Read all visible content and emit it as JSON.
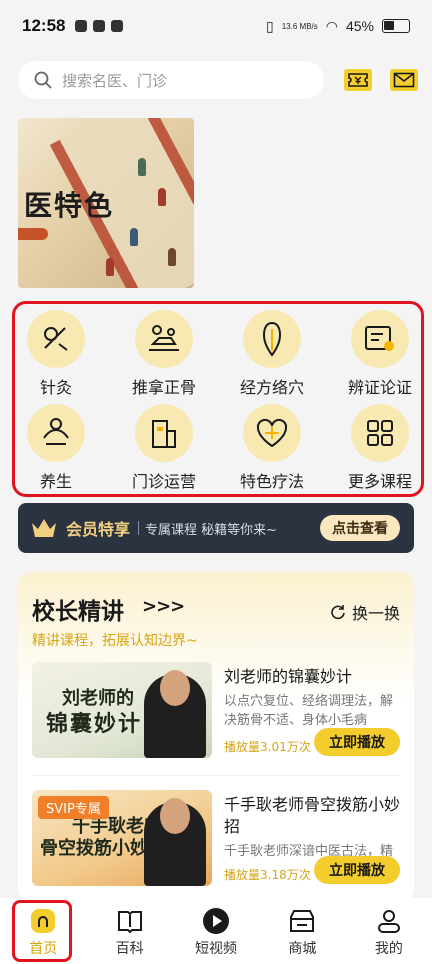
{
  "status_bar": {
    "time": "12:58",
    "speed": "13.6 MB/s",
    "battery": "45%"
  },
  "search": {
    "placeholder": "搜索名医、门诊"
  },
  "banner": {
    "title": "医特色"
  },
  "categories": [
    {
      "label": "针灸",
      "icon": "acupuncture-icon"
    },
    {
      "label": "推拿正骨",
      "icon": "massage-icon"
    },
    {
      "label": "经方络穴",
      "icon": "meridian-icon"
    },
    {
      "label": "辨证论证",
      "icon": "diagnosis-icon"
    },
    {
      "label": "养生",
      "icon": "health-icon"
    },
    {
      "label": "门诊运营",
      "icon": "clinic-icon"
    },
    {
      "label": "特色疗法",
      "icon": "therapy-icon"
    },
    {
      "label": "更多课程",
      "icon": "grid-icon"
    }
  ],
  "member": {
    "title": "会员特享",
    "desc": "专属课程 秘籍等你来~",
    "button": "点击查看"
  },
  "lectures": {
    "title": "校长精讲",
    "arrows": ">>>",
    "refresh": "换一换",
    "subtitle": "精讲课程，拓展认知边界~",
    "courses": [
      {
        "title": "刘老师的锦囊妙计",
        "desc": "以点穴复位、经络调理法，解决筋骨不适、身体小毛病",
        "plays": "播放量3.01万次",
        "button": "立即播放",
        "thumb_line1": "刘老师的",
        "thumb_line2": "锦囊妙计",
        "badge": ""
      },
      {
        "title": "千手耿老师骨空拨筋小妙招",
        "desc": "千手耿老师深谙中医古法，精于骨空拨筋之术",
        "plays": "播放量3.18万次",
        "button": "立即播放",
        "thumb_line1": "千手耿老师",
        "thumb_line2": "骨空拨筋小妙招",
        "badge": "SVIP专属"
      }
    ]
  },
  "nav": [
    {
      "label": "首页",
      "icon": "home-icon",
      "active": true
    },
    {
      "label": "百科",
      "icon": "book-icon",
      "active": false
    },
    {
      "label": "短视频",
      "icon": "play-icon",
      "active": false
    },
    {
      "label": "商城",
      "icon": "shop-icon",
      "active": false
    },
    {
      "label": "我的",
      "icon": "user-icon",
      "active": false
    }
  ],
  "colors": {
    "accent": "#f3cd2e",
    "highlight_red": "#e0141e",
    "gold_text": "#d7a413",
    "member_bg": "#2c3340"
  }
}
